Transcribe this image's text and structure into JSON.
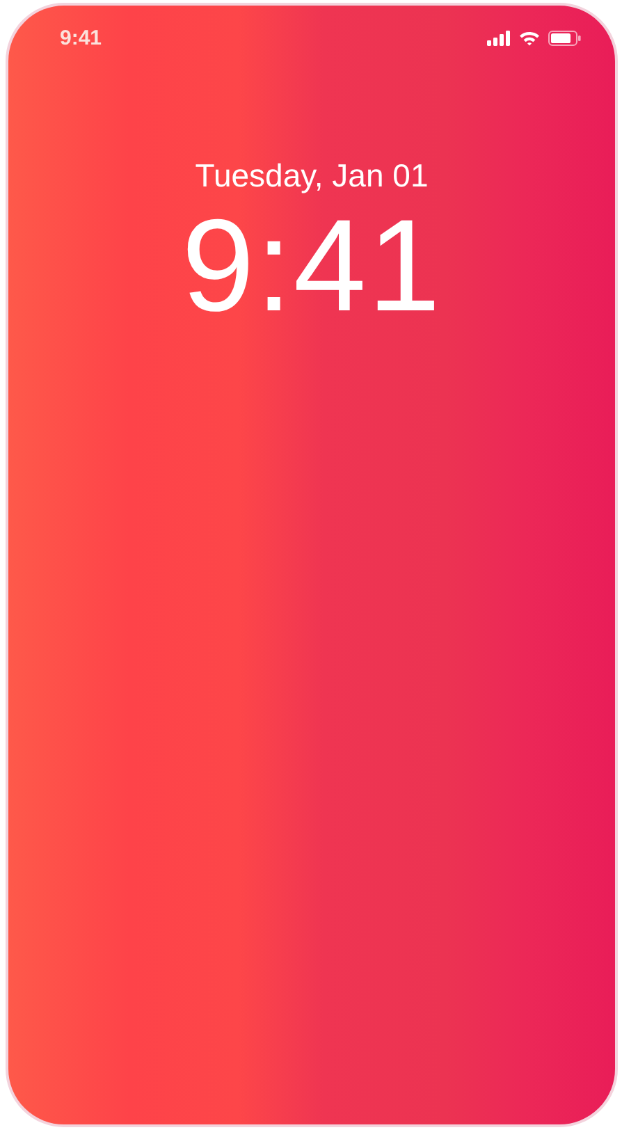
{
  "status_bar": {
    "time": "9:41"
  },
  "lock_screen": {
    "date": "Tuesday, Jan 01",
    "time": "9:41"
  }
}
